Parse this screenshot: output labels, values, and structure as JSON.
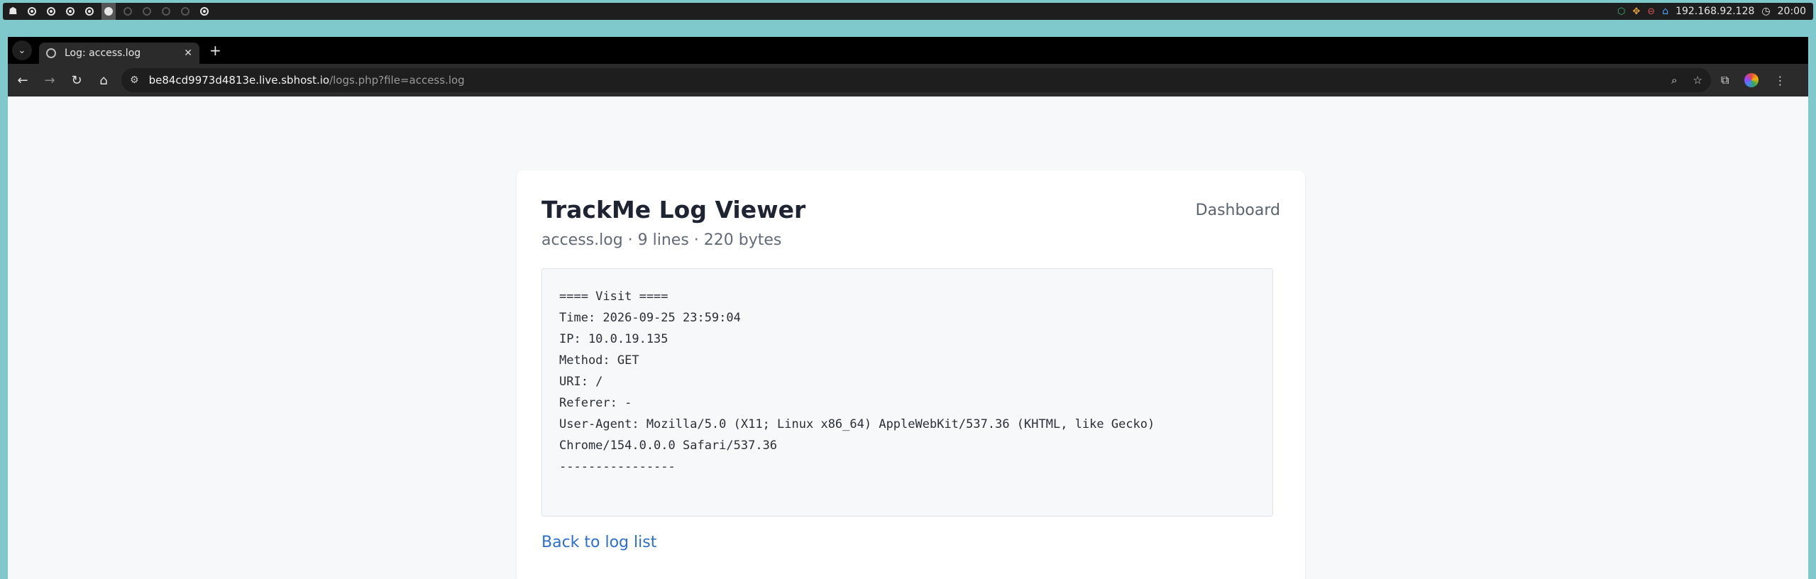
{
  "system_bar": {
    "workspaces": [
      {
        "state": "normal"
      },
      {
        "state": "normal"
      },
      {
        "state": "normal"
      },
      {
        "state": "normal"
      },
      {
        "state": "active"
      },
      {
        "state": "empty"
      },
      {
        "state": "empty"
      },
      {
        "state": "empty"
      },
      {
        "state": "empty"
      },
      {
        "state": "normal"
      }
    ],
    "ip": "192.168.92.128",
    "clock": "20:00"
  },
  "browser": {
    "tab_title": "Log: access.log",
    "url_host": "be84cd9973d4813e.live.sbhost.io",
    "url_path": "/logs.php?file=access.log"
  },
  "page": {
    "title": "TrackMe Log Viewer",
    "nav_link": "Dashboard",
    "meta": "access.log · 9 lines · 220 bytes",
    "log_lines": [
      "==== Visit ====",
      "Time: 2026-09-25 23:59:04",
      "IP: 10.0.19.135",
      "Method: GET",
      "URI: /",
      "Referer: -",
      "User-Agent: Mozilla/5.0 (X11; Linux x86_64) AppleWebKit/537.36 (KHTML, like Gecko)",
      "Chrome/154.0.0.0 Safari/537.36",
      "----------------"
    ],
    "back_link": "Back to log list"
  },
  "colors": {
    "desktop_bg": "#7fc8cc",
    "link": "#2c6fd1",
    "title": "#1f2433"
  }
}
